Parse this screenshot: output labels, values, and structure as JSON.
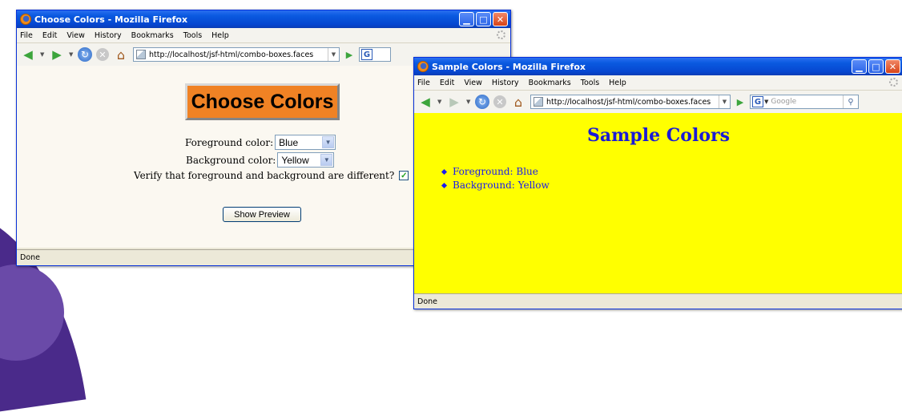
{
  "window1": {
    "title": "Choose Colors - Mozilla Firefox",
    "menu": [
      "File",
      "Edit",
      "View",
      "History",
      "Bookmarks",
      "Tools",
      "Help"
    ],
    "url": "http://localhost/jsf-html/combo-boxes.faces",
    "google_icon": "G",
    "content": {
      "heading": "Choose Colors",
      "foreground_label": "Foreground color:",
      "foreground_value": "Blue",
      "background_label": "Background color:",
      "background_value": "Yellow",
      "verify_label": "Verify that foreground and background are different?",
      "verify_checked": true,
      "show_preview": "Show Preview",
      "heading_bg_color": "#f08224"
    },
    "status": "Done"
  },
  "window2": {
    "title": "Sample Colors - Mozilla Firefox",
    "menu": [
      "File",
      "Edit",
      "View",
      "History",
      "Bookmarks",
      "Tools",
      "Help"
    ],
    "url": "http://localhost/jsf-html/combo-boxes.faces",
    "google_icon": "G",
    "search_placeholder": "Google",
    "content": {
      "heading": "Sample Colors",
      "items": [
        "Foreground: Blue",
        "Background: Yellow"
      ],
      "bg_color": "#ffff00",
      "fg_color": "#1a1aee"
    },
    "status": "Done"
  },
  "icons": {
    "app": "firefox-icon",
    "back": "back-arrow-icon",
    "forward": "forward-arrow-icon",
    "reload": "reload-icon",
    "stop": "stop-icon",
    "home": "home-icon",
    "go": "go-arrow-icon",
    "search": "magnifier-icon"
  }
}
